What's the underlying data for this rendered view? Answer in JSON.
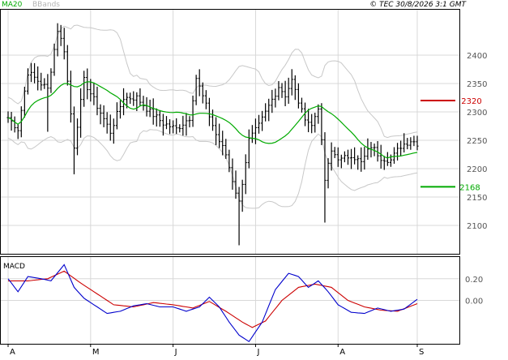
{
  "header": {
    "indicator_ma": "MA20",
    "indicator_bb": "BBands",
    "copyright": "© TEC 30/8/2026 3:1 GMT"
  },
  "colors": {
    "price": "#000000",
    "ma": "#00aa00",
    "bands": "#c8c8c8",
    "resistance": "#cc0000",
    "support": "#00aa00",
    "macd": "#0000cc",
    "signal": "#cc0000",
    "grid": "#d8d8d8"
  },
  "chart_data": [
    {
      "type": "ohlc",
      "title": "",
      "ylim": [
        2050,
        2480
      ],
      "y_ticks": [
        2100,
        2150,
        2200,
        2250,
        2300,
        2350,
        2400
      ],
      "x_ticks": [
        "A",
        "M",
        "J",
        "J",
        "A",
        "S"
      ],
      "x_tick_index": [
        0,
        25,
        50,
        75,
        100,
        124
      ],
      "n_bars": 125,
      "price_anchors": [
        [
          0,
          2290
        ],
        [
          3,
          2270
        ],
        [
          6,
          2370
        ],
        [
          9,
          2355
        ],
        [
          12,
          2340
        ],
        [
          15,
          2445
        ],
        [
          17,
          2410
        ],
        [
          20,
          2240
        ],
        [
          23,
          2355
        ],
        [
          27,
          2310
        ],
        [
          31,
          2265
        ],
        [
          35,
          2325
        ],
        [
          39,
          2325
        ],
        [
          43,
          2300
        ],
        [
          47,
          2280
        ],
        [
          51,
          2270
        ],
        [
          55,
          2290
        ],
        [
          57,
          2360
        ],
        [
          60,
          2310
        ],
        [
          63,
          2260
        ],
        [
          66,
          2225
        ],
        [
          68,
          2180
        ],
        [
          70,
          2140
        ],
        [
          73,
          2250
        ],
        [
          76,
          2275
        ],
        [
          79,
          2310
        ],
        [
          82,
          2345
        ],
        [
          84,
          2330
        ],
        [
          86,
          2355
        ],
        [
          89,
          2300
        ],
        [
          92,
          2275
        ],
        [
          94,
          2310
        ],
        [
          96,
          2180
        ],
        [
          98,
          2230
        ],
        [
          101,
          2215
        ],
        [
          104,
          2225
        ],
        [
          107,
          2210
        ],
        [
          110,
          2240
        ],
        [
          113,
          2220
        ],
        [
          116,
          2215
        ],
        [
          119,
          2240
        ],
        [
          122,
          2250
        ],
        [
          124,
          2245
        ]
      ],
      "spikes": [
        [
          12,
          2265
        ],
        [
          20,
          2190
        ],
        [
          70,
          2065
        ],
        [
          96,
          2105
        ]
      ],
      "ma20_label": "MA20",
      "bbands_label": "BBands",
      "levels": [
        {
          "name": "resistance",
          "value": 2320,
          "label": "2320"
        },
        {
          "name": "support",
          "value": 2168,
          "label": "2168"
        }
      ]
    },
    {
      "type": "line",
      "title": "MACD",
      "ylim": [
        -40,
        40
      ],
      "y_ticks": [
        20,
        0
      ],
      "y_tick_labels": [
        "0.20",
        "0.00"
      ],
      "macd_anchors": [
        [
          0,
          20
        ],
        [
          3,
          8
        ],
        [
          6,
          22
        ],
        [
          10,
          20
        ],
        [
          13,
          18
        ],
        [
          17,
          33
        ],
        [
          20,
          12
        ],
        [
          23,
          2
        ],
        [
          26,
          -4
        ],
        [
          30,
          -12
        ],
        [
          34,
          -10
        ],
        [
          38,
          -5
        ],
        [
          42,
          -3
        ],
        [
          46,
          -6
        ],
        [
          50,
          -6
        ],
        [
          54,
          -10
        ],
        [
          58,
          -6
        ],
        [
          61,
          3
        ],
        [
          64,
          -6
        ],
        [
          67,
          -20
        ],
        [
          70,
          -32
        ],
        [
          73,
          -38
        ],
        [
          77,
          -20
        ],
        [
          81,
          10
        ],
        [
          85,
          25
        ],
        [
          88,
          22
        ],
        [
          91,
          12
        ],
        [
          94,
          18
        ],
        [
          97,
          8
        ],
        [
          100,
          -4
        ],
        [
          104,
          -11
        ],
        [
          108,
          -12
        ],
        [
          112,
          -7
        ],
        [
          116,
          -10
        ],
        [
          120,
          -8
        ],
        [
          124,
          1
        ]
      ],
      "signal_anchors": [
        [
          0,
          18
        ],
        [
          6,
          18
        ],
        [
          12,
          20
        ],
        [
          17,
          27
        ],
        [
          22,
          16
        ],
        [
          27,
          6
        ],
        [
          32,
          -4
        ],
        [
          38,
          -6
        ],
        [
          44,
          -2
        ],
        [
          50,
          -4
        ],
        [
          56,
          -7
        ],
        [
          61,
          -1
        ],
        [
          66,
          -10
        ],
        [
          71,
          -20
        ],
        [
          74,
          -25
        ],
        [
          78,
          -19
        ],
        [
          83,
          0
        ],
        [
          88,
          12
        ],
        [
          93,
          15
        ],
        [
          98,
          12
        ],
        [
          103,
          0
        ],
        [
          108,
          -6
        ],
        [
          113,
          -9
        ],
        [
          118,
          -10
        ],
        [
          124,
          -3
        ]
      ]
    }
  ]
}
